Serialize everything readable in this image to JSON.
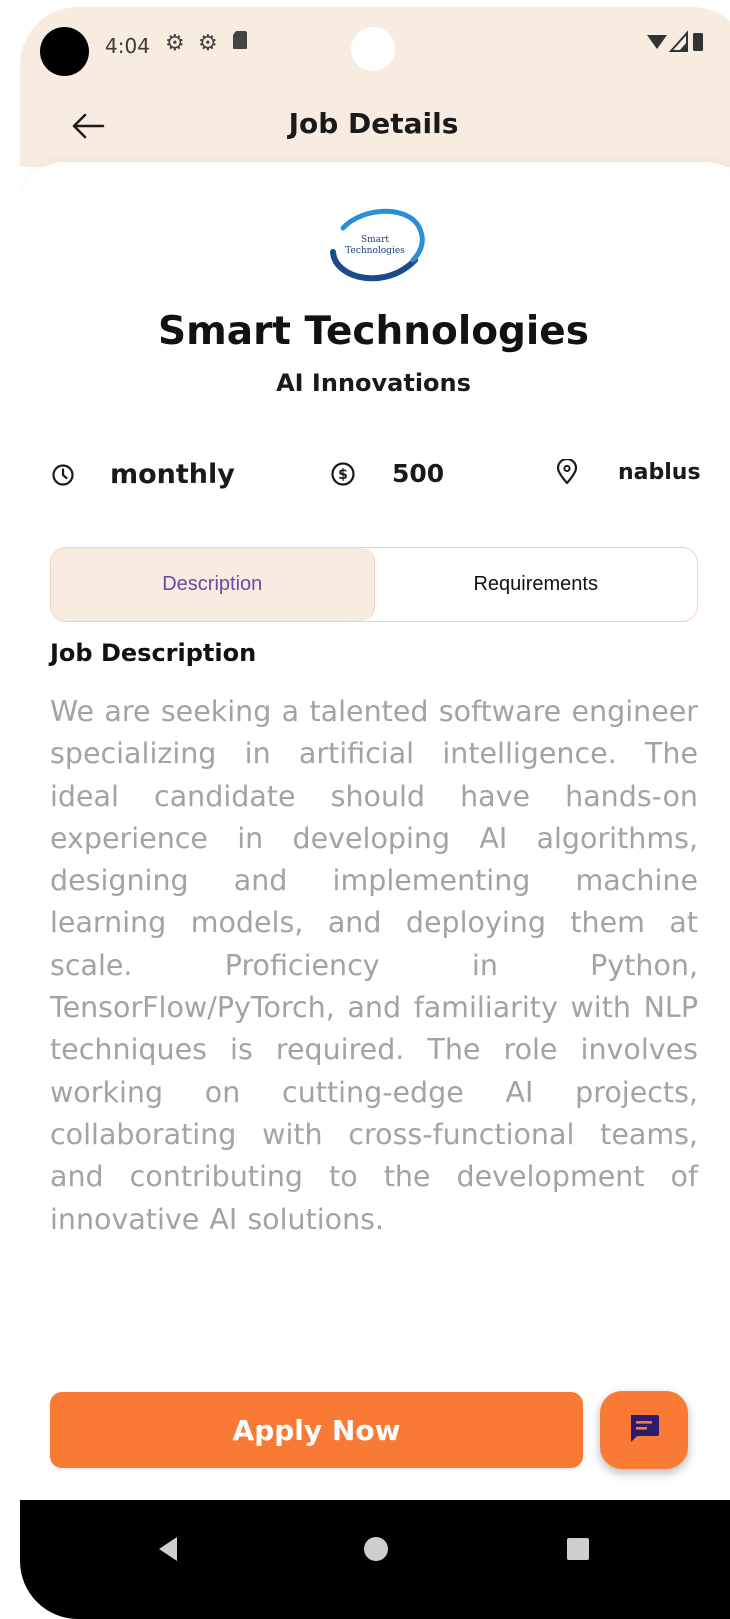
{
  "status_bar": {
    "time": "4:04",
    "icons": [
      "gear-icon",
      "gear-icon",
      "sd-card-icon"
    ],
    "right_icons": [
      "wifi-icon",
      "signal-icon",
      "battery-icon"
    ]
  },
  "header": {
    "title": "Job Details",
    "back_icon": "arrow-left-icon"
  },
  "company": {
    "logo_text_line1": "Smart",
    "logo_text_line2": "Technologies",
    "name": "Smart Technologies",
    "department": "AI Innovations"
  },
  "job_meta": {
    "salary_period": "monthly",
    "salary_amount": "500",
    "location": "nablus"
  },
  "tabs": [
    {
      "label": "Description",
      "active": true
    },
    {
      "label": "Requirements",
      "active": false
    }
  ],
  "content": {
    "section_title": "Job Description",
    "description": "We are seeking a talented software engineer specializing in artificial intelligence. The ideal candidate should have hands-on experience in developing AI algorithms, designing and implementing machine learning models, and deploying them at scale. Proficiency in Python, TensorFlow/PyTorch, and familiarity with NLP techniques is required. The role involves working on cutting-edge AI projects, collaborating with cross-functional teams, and contributing to the development of innovative AI solutions."
  },
  "actions": {
    "apply_label": "Apply Now",
    "chat_icon": "chat-icon"
  },
  "colors": {
    "accent": "#f97a35",
    "header_bg": "#f8ebe0",
    "tab_active_text": "#6a4aa8",
    "chat_icon_color": "#2d1b6e",
    "logo_blue": "#2a6fb5",
    "description_text": "#a3a3a3"
  }
}
